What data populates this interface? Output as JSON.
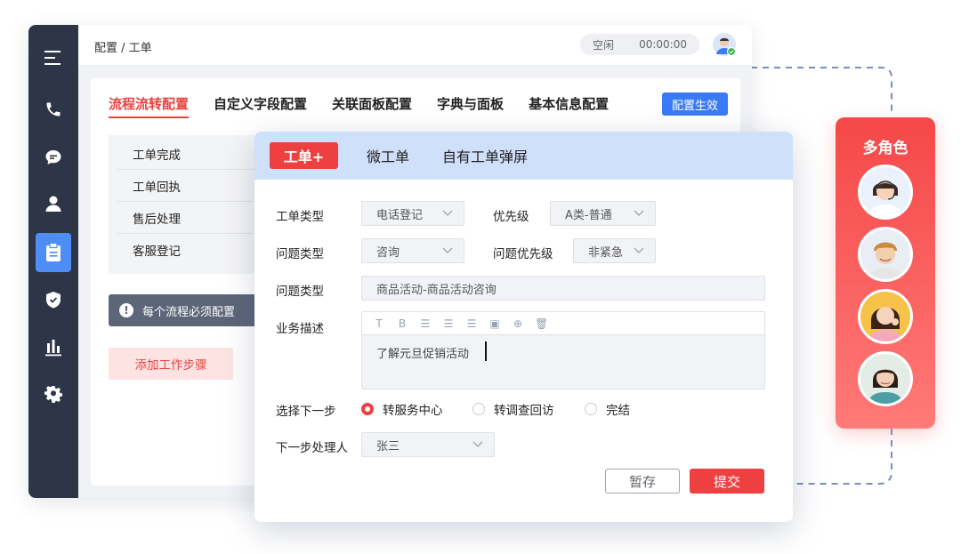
{
  "app": {
    "breadcrumb": "配置 / 工单",
    "status": {
      "state": "空闲",
      "timer": "00:00:00"
    }
  },
  "sidebar": {
    "items": [
      {
        "icon": "menu-icon"
      },
      {
        "icon": "phone-icon"
      },
      {
        "icon": "chat-icon"
      },
      {
        "icon": "user-icon"
      },
      {
        "icon": "ticket-icon",
        "active": true
      },
      {
        "icon": "shield-icon"
      },
      {
        "icon": "bar-chart-icon"
      },
      {
        "icon": "gear-icon"
      }
    ]
  },
  "config": {
    "tabs": [
      {
        "label": "流程流转配置",
        "active": true
      },
      {
        "label": "自定义字段配置"
      },
      {
        "label": "关联面板配置"
      },
      {
        "label": "字典与面板"
      },
      {
        "label": "基本信息配置"
      }
    ],
    "apply_label": "配置生效",
    "flows": [
      "工单完成",
      "工单回执",
      "售后处理",
      "客服登记"
    ],
    "notice": "每个流程必须配置",
    "add_step_label": "添加工作步骤"
  },
  "dialog": {
    "tabs": [
      {
        "label": "工单+",
        "active": true
      },
      {
        "label": "微工单"
      },
      {
        "label": "自有工单弹屏"
      }
    ],
    "fields": {
      "ticket_type": {
        "label": "工单类型",
        "value": "电话登记"
      },
      "priority": {
        "label": "优先级",
        "value": "A类-普通"
      },
      "issue_type": {
        "label": "问题类型",
        "value": "咨询"
      },
      "issue_priority": {
        "label": "问题优先级",
        "value": "非紧急"
      },
      "issue_type2": {
        "label": "问题类型",
        "value": "商品活动-商品活动咨询"
      },
      "description": {
        "label": "业务描述",
        "value": "了解元旦促销活动"
      },
      "next_step": {
        "label": "选择下一步",
        "options": [
          "转服务中心",
          "转调查回访",
          "完结"
        ],
        "selected": 0
      },
      "handler": {
        "label": "下一步处理人",
        "value": "张三"
      }
    },
    "toolbar": [
      "T",
      "B",
      "☰",
      "☰",
      "☰",
      "▣",
      "⊕",
      "🗑"
    ],
    "save_label": "暂存",
    "submit_label": "提交"
  },
  "roles": {
    "title": "多角色"
  },
  "colors": {
    "accent_red": "#ee4040",
    "accent_blue": "#3a7bf5",
    "sidebar_bg": "#2d3547"
  }
}
